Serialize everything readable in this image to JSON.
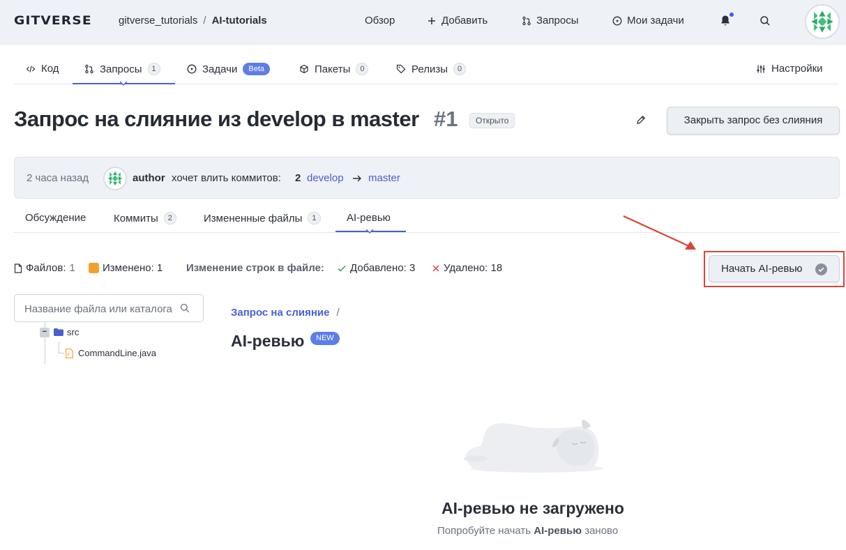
{
  "header": {
    "logo": "GITVERSE",
    "crumb_sep": "/",
    "owner": "gitverse_tutorials",
    "repo": "AI-tutorials",
    "nav": {
      "overview": "Обзор",
      "add": "Добавить",
      "requests": "Запросы",
      "my_tasks": "Мои задачи"
    }
  },
  "repo_tabs": [
    {
      "label": "Код",
      "icon": "code-icon"
    },
    {
      "label": "Запросы",
      "count": "1",
      "icon": "pull-request-icon"
    },
    {
      "label": "Задачи",
      "badge": "Beta",
      "icon": "issue-icon"
    },
    {
      "label": "Пакеты",
      "count": "0",
      "icon": "package-icon"
    },
    {
      "label": "Релизы",
      "count": "0",
      "icon": "tag-icon"
    },
    {
      "label": "Настройки",
      "icon": "settings-icon"
    }
  ],
  "pr": {
    "title": "Запрос на слияние из develop в master",
    "number": "#1",
    "status": "Открыто",
    "close_button": "Закрыть запрос без слияния"
  },
  "info": {
    "time": "2 часа назад",
    "author": "author",
    "wants": "хочет влить коммитов:",
    "commits": "2",
    "from": "develop",
    "to": "master"
  },
  "pr_tabs": [
    {
      "label": "Обсуждение"
    },
    {
      "label": "Коммиты",
      "count": "2"
    },
    {
      "label": "Измененные файлы",
      "count": "1"
    },
    {
      "label": "AI-ревью"
    }
  ],
  "stats": {
    "files_label": "Файлов:",
    "files_value": "1",
    "changed_label": "Изменено: 1",
    "lines_label": "Изменение строк в файле:",
    "added": "Добавлено: 3",
    "removed": "Удалено: 18"
  },
  "start_ai_button": "Начать AI-ревью",
  "file_search": {
    "placeholder": "Название файла или каталога"
  },
  "tree": {
    "folder": "src",
    "file": "CommandLine.java"
  },
  "main": {
    "breadcrumb": "Запрос на слияние",
    "breadcrumb_sep": "/",
    "heading": "AI-ревью",
    "new_badge": "NEW",
    "empty_title": "AI-ревью не загружено",
    "empty_sub_before": "Попробуйте начать",
    "empty_sub_bold": "AI-ревью",
    "empty_sub_after": "заново"
  },
  "colors": {
    "accent": "#4b5fcf",
    "badge": "#5d7de8",
    "annotation": "#d9443a",
    "modified": "#f2a02c",
    "added": "#2fa35a",
    "removed": "#d9443a"
  }
}
